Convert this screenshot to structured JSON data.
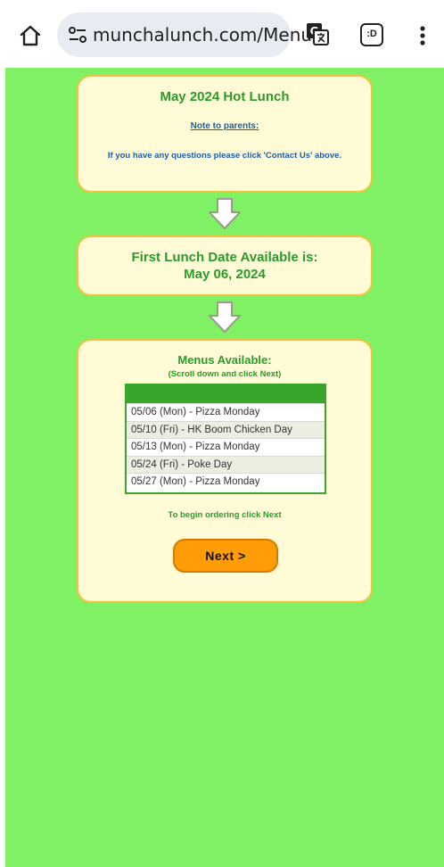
{
  "browser": {
    "url": "munchalunch.com/Menu",
    "tabs_label": ":D",
    "icons": {
      "home": "home-icon",
      "site_info": "tune-icon",
      "translate": "translate-icon",
      "tabs": "tabs-icon",
      "menu": "more-vert-icon"
    }
  },
  "intro_card": {
    "title": "May 2024 Hot Lunch",
    "note_link": "Note to parents:",
    "info": "If you have any questions please click 'Contact Us' above."
  },
  "date_card": {
    "line1": "First Lunch Date Available is:",
    "line2": "May 06, 2024"
  },
  "menus_card": {
    "title": "Menus Available:",
    "subtitle": "(Scroll down and click Next)",
    "items": [
      "05/06 (Mon) - Pizza Monday",
      "05/10 (Fri) - HK Boom Chicken Day",
      "05/13 (Mon) - Pizza Monday",
      "05/24 (Fri) - Poke Day",
      "05/27 (Mon) - Pizza Monday"
    ],
    "begin_text": "To begin ordering click Next",
    "next_label": "Next >"
  },
  "colors": {
    "background": "#80f064",
    "card": "#fffbd7",
    "card_border": "#f2c23d",
    "heading_green": "#2b9a2b",
    "link_blue": "#1b5fa4",
    "next_button": "#ff9c06"
  }
}
